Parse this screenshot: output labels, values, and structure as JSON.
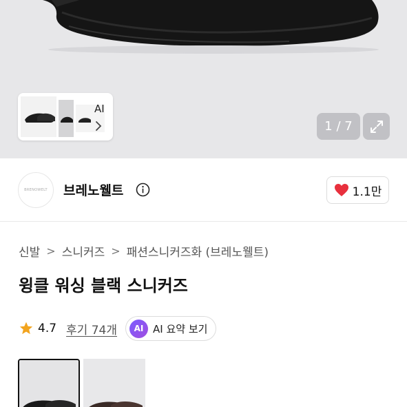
{
  "gallery": {
    "counter": "1 / 7",
    "ai_card_label": "AI",
    "icons": {
      "expand": "expand-icon",
      "chevron": "chevron-right-icon"
    }
  },
  "brand": {
    "name": "브레노웰트",
    "logo_text": "BRENOWELT",
    "likes": "1.1만",
    "icons": {
      "info": "info-icon",
      "heart": "heart-icon"
    },
    "heart_color": "#e8303d"
  },
  "breadcrumb": [
    "신발",
    "스니커즈",
    "패션스니커즈화 (브레노웰트)"
  ],
  "product": {
    "title": "윙클 워싱 블랙 스니커즈",
    "rating": "4.7",
    "reviews": "후기 74개",
    "ai_badge": "AI",
    "ai_summary": "AI 요약 보기",
    "star_color": "#f2a41f"
  }
}
